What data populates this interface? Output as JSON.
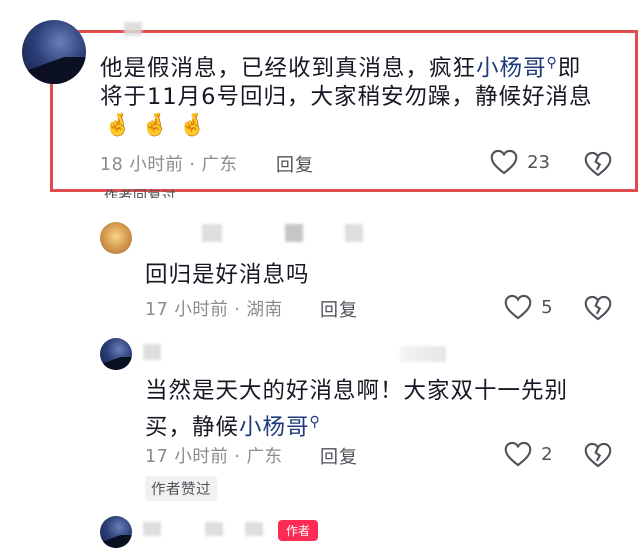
{
  "comments": [
    {
      "text_line1_before": "他是假消息，已经收到真消息，疯狂",
      "link_text": "小杨哥",
      "text_line1_after": "即",
      "text_line2": "将于11月6号回归，大家稍安勿躁，静候好消息",
      "emojis": "🤞🤞🤞",
      "time_location": "18 小时前 · 广东",
      "reply_label": "回复",
      "likes": "23",
      "tag": "作者回复过"
    },
    {
      "text": "回归是好消息吗",
      "time_location": "17 小时前 · 湖南",
      "reply_label": "回复",
      "likes": "5"
    },
    {
      "text_line1": "当然是天大的好消息啊！大家双十一先别",
      "text_line2_before": "买，静候",
      "link_text": "小杨哥",
      "time_location": "17 小时前 · 广东",
      "reply_label": "回复",
      "likes": "2",
      "tag": "作者赞过"
    }
  ],
  "author_badge": "作者",
  "icons": {
    "like": "heart-icon",
    "dislike": "broken-heart-icon",
    "search": "search-icon"
  },
  "colors": {
    "highlight_box": "#e14d4d",
    "link": "#1f3b7a",
    "meta": "#8a8b91"
  }
}
